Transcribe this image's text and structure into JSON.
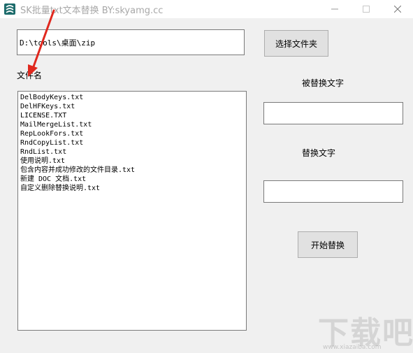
{
  "window": {
    "title": "SK批量txt文本替换 BY:skyamg.cc",
    "icon": "app-icon"
  },
  "path_field": {
    "value": "D:\\tools\\桌面\\zip"
  },
  "buttons": {
    "select_folder": "选择文件夹",
    "start_replace": "开始替换"
  },
  "labels": {
    "filename": "文件名",
    "find_text": "被替换文字",
    "replace_text": "替换文字"
  },
  "inputs": {
    "find_value": "",
    "replace_value": ""
  },
  "file_list": [
    "DelBodyKeys.txt",
    "DelHFKeys.txt",
    "LICENSE.TXT",
    "MailMergeList.txt",
    "RepLookFors.txt",
    "RndCopyList.txt",
    "RndList.txt",
    "使用说明.txt",
    "包含内容并成功修改的文件目录.txt",
    "新建 DOC 文档.txt",
    "自定义删除替换说明.txt"
  ],
  "watermark": {
    "text": "下载吧",
    "sub": "www.xiazaiba.com"
  },
  "colors": {
    "window_bg": "#f0f0f0",
    "annotation_arrow": "#e0281e"
  }
}
